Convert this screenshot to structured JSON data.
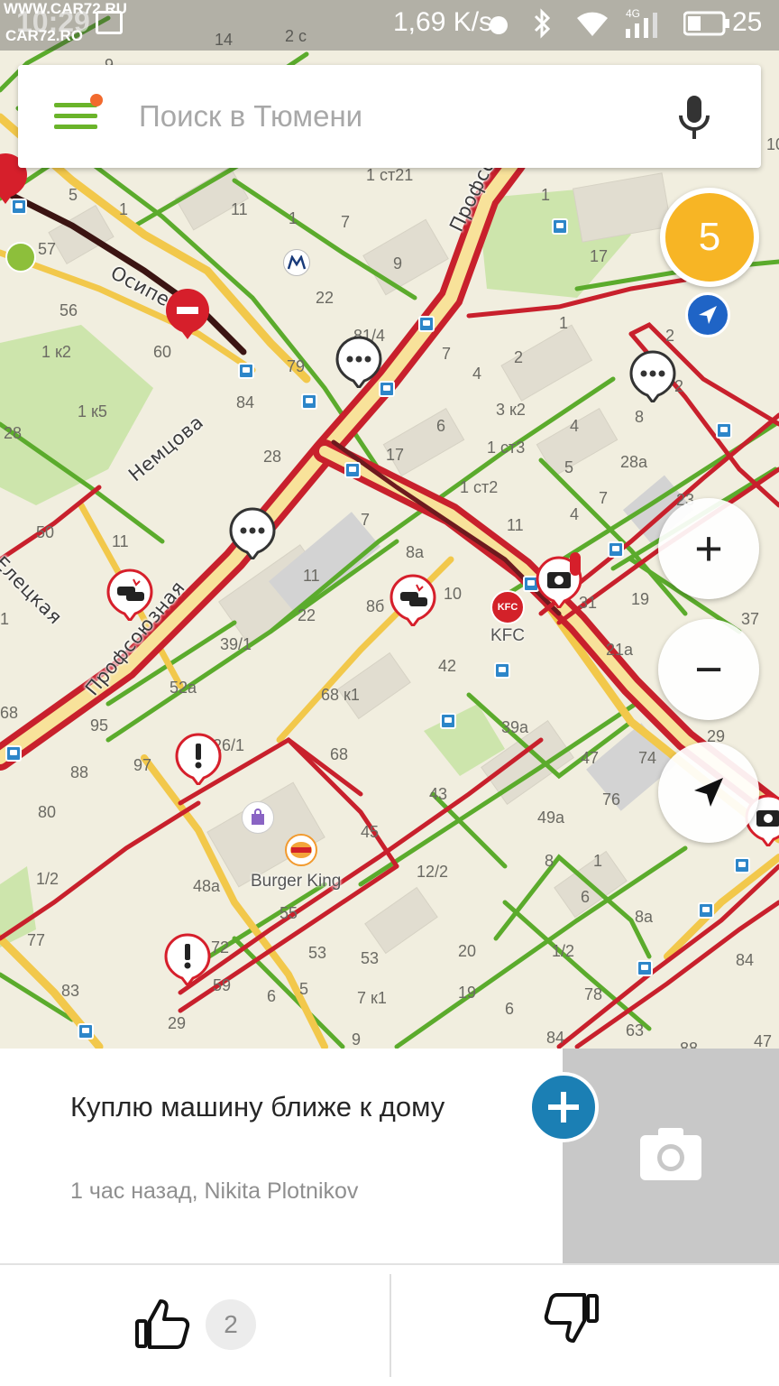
{
  "status_bar": {
    "watermark_top": "WWW.CAR72.RU",
    "watermark_bottom": "CAR72.RO",
    "time": "10:29",
    "net_speed": "1,69 K/s",
    "battery_pct": "25",
    "signal": "4G"
  },
  "search": {
    "placeholder": "Поиск в Тюмени",
    "menu_icon": "hamburger-menu-icon",
    "voice_icon": "microphone-icon"
  },
  "map": {
    "traffic_score": "5",
    "streets": [
      "Профсоюзная",
      "Профсоюзная",
      "Немцова",
      "Осипенко",
      "Елецкая"
    ],
    "pois": [
      "KFC",
      "Burger King"
    ],
    "house_numbers": [
      "14",
      "2 с",
      "9",
      "5",
      "1",
      "11",
      "1",
      "7",
      "1 ст21",
      "1",
      "57",
      "9",
      "17",
      "56",
      "22",
      "1 к2",
      "60",
      "79",
      "81/4",
      "7",
      "2",
      "4",
      "1",
      "84",
      "1 к5",
      "6",
      "3 к2",
      "4",
      "2",
      "28",
      "17",
      "1 ст3",
      "5",
      "28а",
      "8",
      "1 ст2",
      "7",
      "23",
      "50",
      "11",
      "7",
      "11",
      "4",
      "8а",
      "11",
      "19",
      "10",
      "31",
      "37",
      "22",
      "8б",
      "39/1",
      "42",
      "21а",
      "52а",
      "68 к1",
      "95",
      "26/1",
      "68",
      "39а",
      "29",
      "88",
      "97",
      "47",
      "74",
      "43",
      "76",
      "80",
      "45",
      "49а",
      "12/2",
      "8",
      "1",
      "1/2",
      "48а",
      "55",
      "6",
      "8а",
      "1/2",
      "77",
      "72",
      "53",
      "53",
      "20",
      "84",
      "83",
      "59",
      "6",
      "5",
      "7 к1",
      "19",
      "78",
      "29",
      "6",
      "84",
      "63",
      "9",
      "88",
      "47",
      "68",
      "1",
      "10",
      "2",
      "28"
    ],
    "markers": [
      "chat-marker",
      "chat-marker",
      "chat-marker",
      "road-closed-marker",
      "accident-marker",
      "accident-marker",
      "camera-marker",
      "warning-marker",
      "warning-marker",
      "camera-marker"
    ]
  },
  "controls": {
    "zoom_in": "+",
    "zoom_out": "−",
    "locate_icon": "navigation-arrow-icon"
  },
  "event": {
    "title": "Куплю машину ближе к дому",
    "meta": "1 час назад, Nikita Plotnikov",
    "add_photo_icon": "plus-icon",
    "photo_icon": "camera-icon"
  },
  "actions": {
    "like_icon": "thumbs-up-icon",
    "like_count": "2",
    "dislike_icon": "thumbs-down-icon"
  },
  "colors": {
    "road_green": "#5bab2c",
    "road_yellow": "#f2c84b",
    "road_red": "#c8202c",
    "road_darkred": "#6d1a1e",
    "accent_blue": "#1b7fb4",
    "menu_green": "#6ab42a",
    "traffic_yellow": "#f7b525"
  }
}
